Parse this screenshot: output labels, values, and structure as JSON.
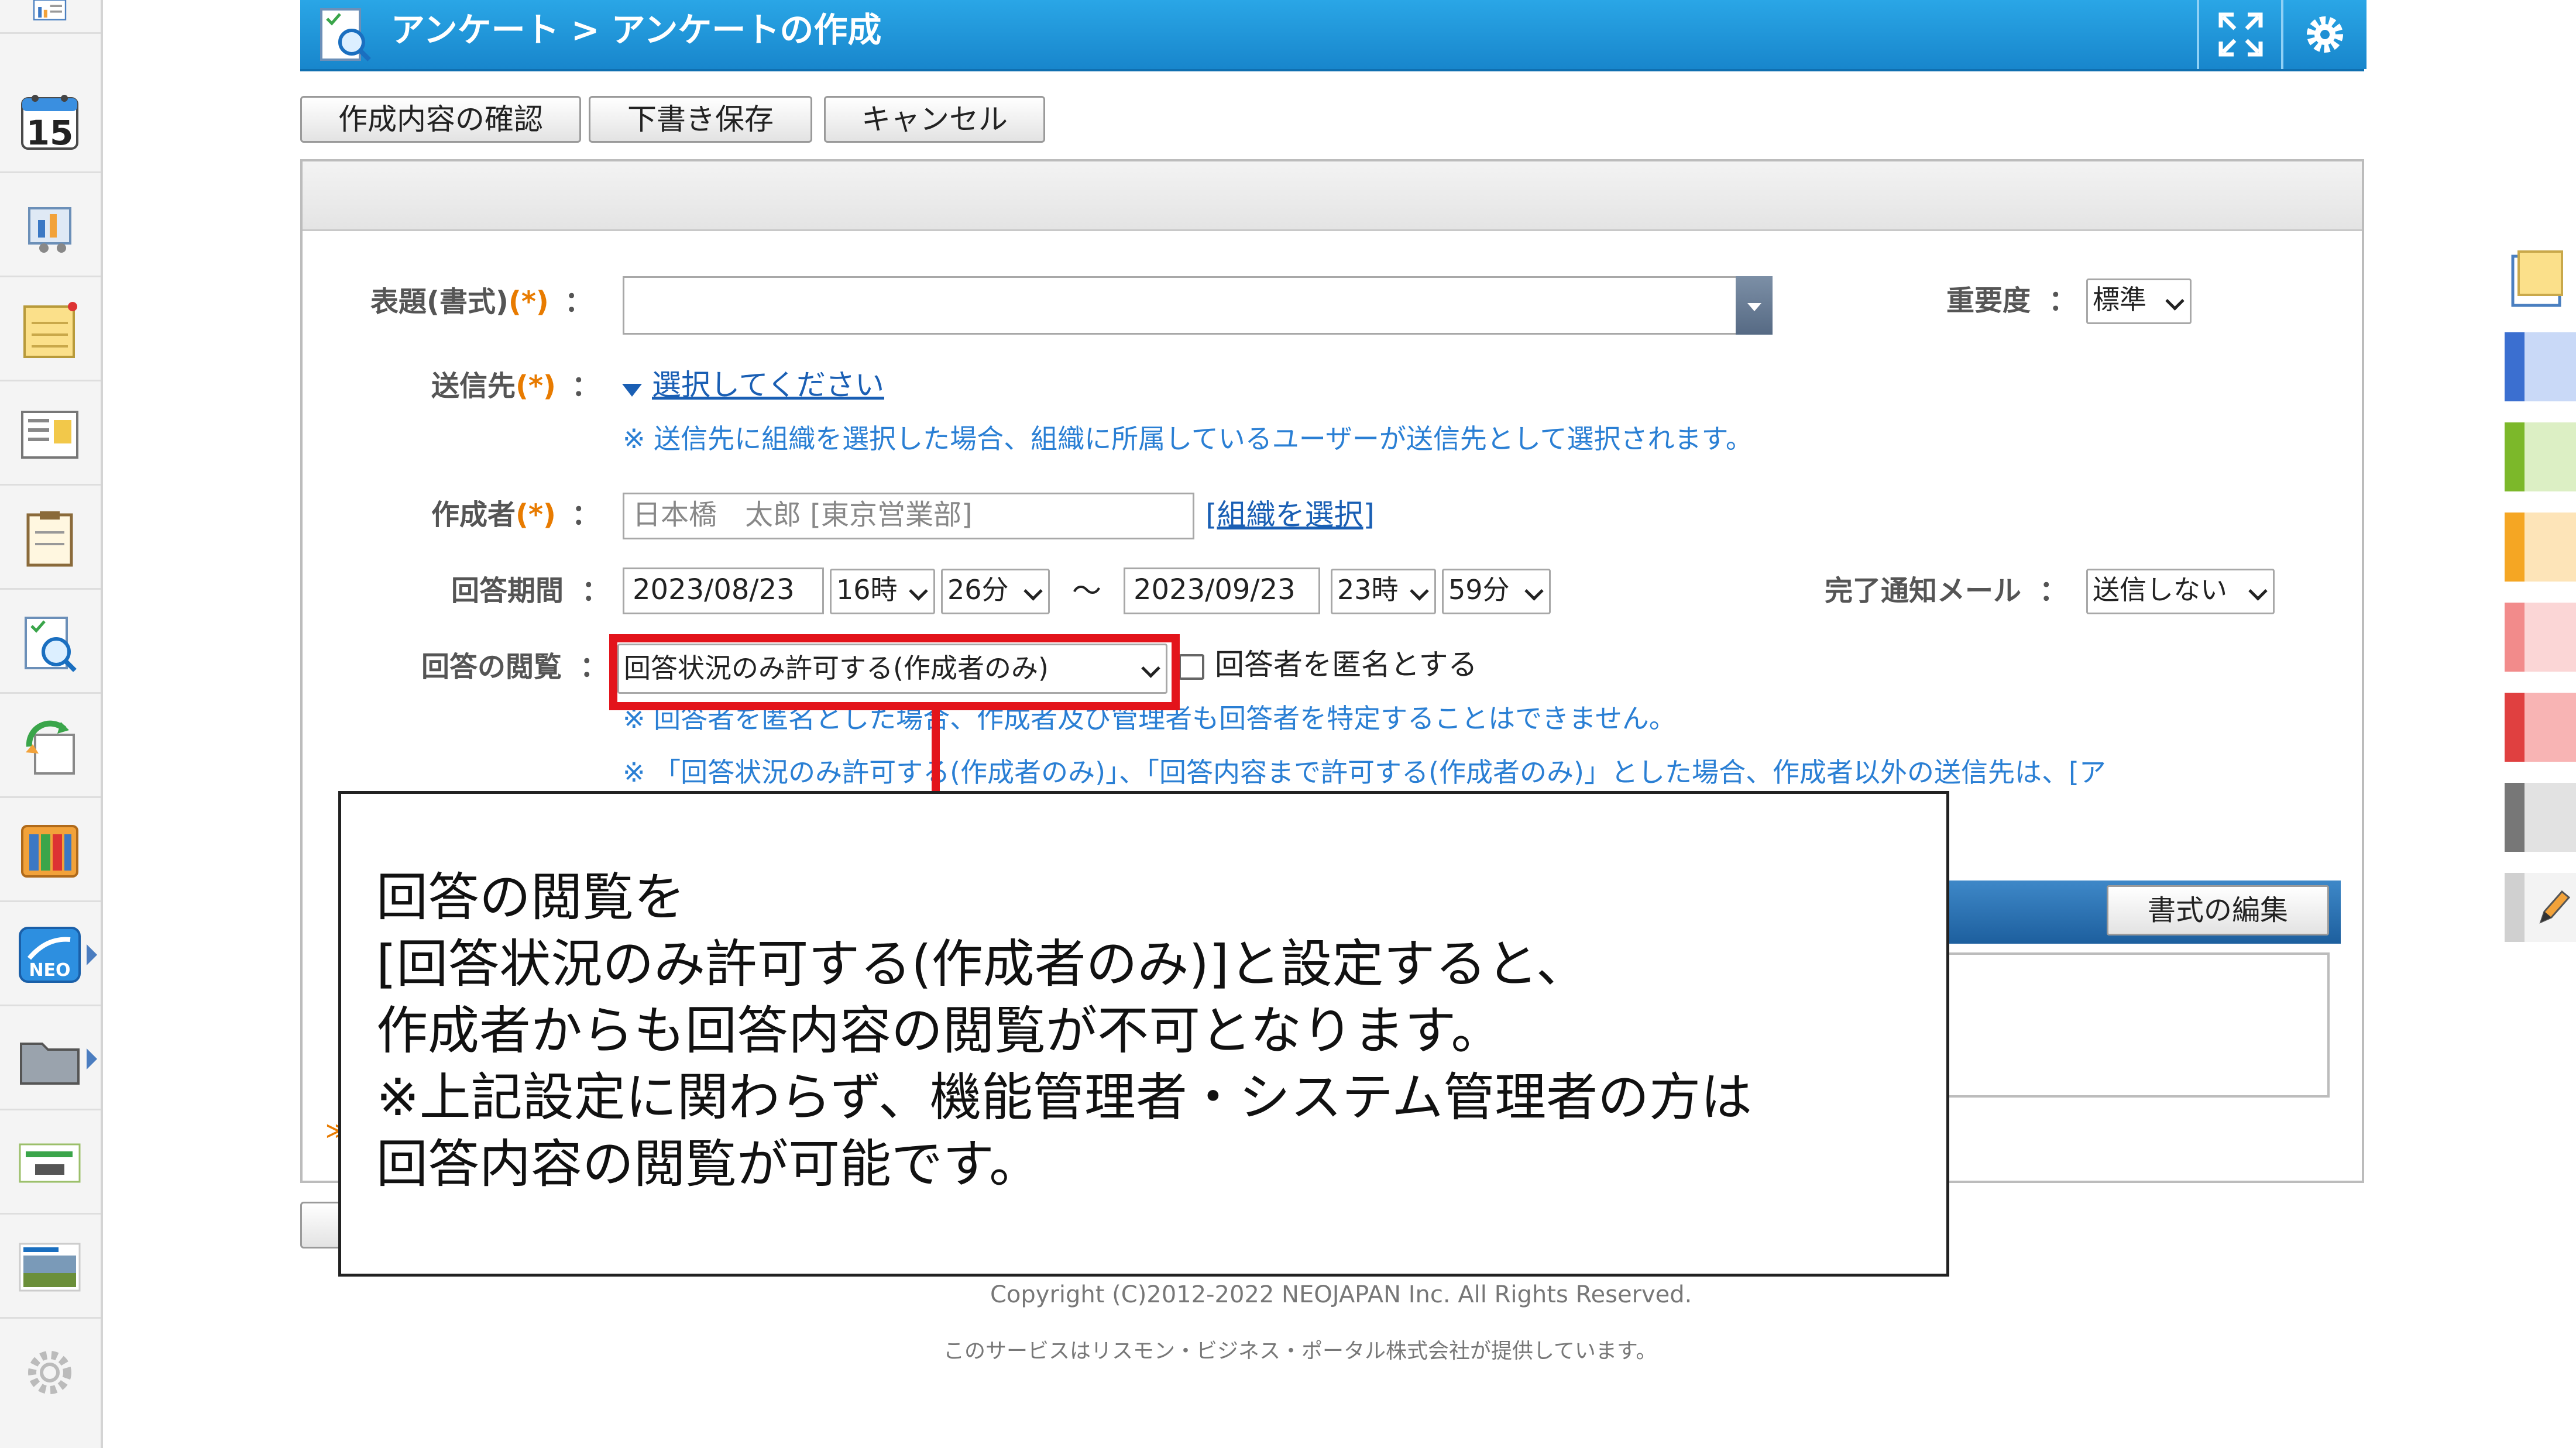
{
  "header": {
    "title": "アンケート > アンケートの作成"
  },
  "toolbar": {
    "confirm_label": "作成内容の確認",
    "draft_label": "下書き保存",
    "cancel_label": "キャンセル"
  },
  "sidebar": {
    "calendar_day": "15"
  },
  "form": {
    "title_label": "表題(書式)",
    "required_mark": "(*)",
    "colon": "：",
    "priority_label": "重要度",
    "priority_value": "標準",
    "recipient_label": "送信先",
    "recipient_link": "選択してください",
    "recipient_note": "※ 送信先に組織を選択した場合、組織に所属しているユーザーが送信先として選択されます。",
    "author_label": "作成者",
    "author_value": "日本橋　太郎 [東京営業部]",
    "org_select_link": "[組織を選択]",
    "period_label": "回答期間",
    "start_date": "2023/08/23",
    "start_hour": "16時",
    "start_minute": "26分",
    "tilde": "～",
    "end_date": "2023/09/23",
    "end_hour": "23時",
    "end_minute": "59分",
    "notify_label": "完了通知メール",
    "notify_value": "送信しない",
    "view_label": "回答の閲覧",
    "view_value": "回答状況のみ許可する(作成者のみ)",
    "anonymous_label": "回答者を匿名とする",
    "note_anonymous": "※ 回答者を匿名とした場合、作成者及び管理者も回答者を特定することはできません。",
    "note_view": "※ 「回答状況のみ許可する(作成者のみ)」、「回答内容まで許可する(作成者のみ)」とした場合、作成者以外の送信先は、[ア",
    "format_edit_label": "書式の編集"
  },
  "callout": {
    "lines": [
      "回答の閲覧を",
      "[回答状況のみ許可する(作成者のみ)]と設定すると、",
      "作成者からも回答内容の閲覧が不可となります。",
      "※上記設定に関わらず、機能管理者・システム管理者の方は",
      "回答内容の閲覧が可能です。"
    ]
  },
  "footer": {
    "copyright": "Copyright (C)2012-2022 NEOJAPAN Inc. All Rights Reserved.",
    "service": "このサービスはリスモン・ビジネス・ポータル株式会社が提供しています。"
  },
  "colors": {
    "header_blue": "#1e95d8",
    "highlight_red": "#e3141b",
    "required_orange": "#e87b00",
    "note_blue": "#2a7fd4"
  }
}
